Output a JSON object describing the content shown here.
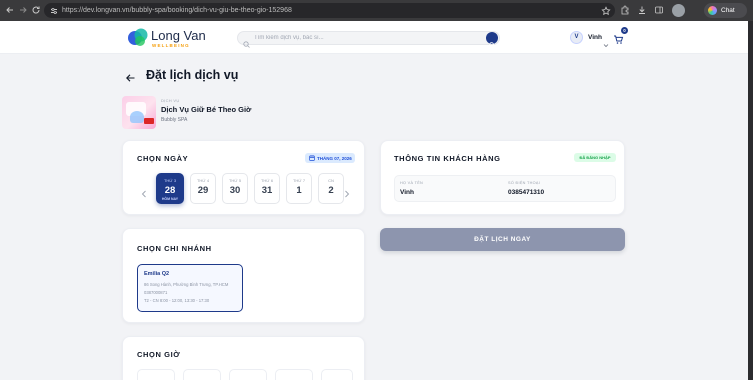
{
  "browser": {
    "url": "https://dev.longvan.vn/bubbly-spa/booking/dich-vu-giu-be-theo-gio-152968",
    "chat_label": "Chat"
  },
  "header": {
    "logo_name": "Long Van",
    "logo_tagline": "WELLBEING",
    "search_placeholder": "Tìm kiếm dịch vụ, bác sĩ...",
    "user_initial": "V",
    "user_name": "Vinh",
    "cart_count": "0"
  },
  "page": {
    "title": "Đặt lịch dịch vụ"
  },
  "service": {
    "category": "DỊCH VỤ",
    "name": "Dịch Vụ Giữ Bé Theo Giờ",
    "provider": "Bubbly SPA"
  },
  "date_picker": {
    "heading": "CHỌN NGÀY",
    "month_badge": "THÁNG 07, 2026",
    "days": [
      {
        "weekday": "THỨ 3",
        "day": "28",
        "note": "HÔM NAY",
        "selected": true
      },
      {
        "weekday": "THỨ 4",
        "day": "29"
      },
      {
        "weekday": "THỨ 5",
        "day": "30"
      },
      {
        "weekday": "THỨ 6",
        "day": "31"
      },
      {
        "weekday": "THỨ 7",
        "day": "1"
      },
      {
        "weekday": "CN",
        "day": "2"
      }
    ]
  },
  "branch_picker": {
    "heading": "CHỌN CHI NHÁNH",
    "branches": [
      {
        "name": "Emilia Q2",
        "address": "86 Song Hành, Phường Bình Trưng, TP.HCM",
        "phone": "0387000871",
        "hours": "T2 - CN 8:00 - 12:00, 13:30 - 17:30",
        "selected": true
      }
    ]
  },
  "time_picker": {
    "heading": "CHỌN GIỜ"
  },
  "customer": {
    "heading": "THÔNG TIN KHÁCH HÀNG",
    "status_badge": "ĐÃ ĐĂNG NHẬP",
    "fields": [
      {
        "label": "HỌ VÀ TÊN",
        "value": "Vinh"
      },
      {
        "label": "SỐ ĐIỆN THOẠI",
        "value": "0385471310"
      }
    ]
  },
  "actions": {
    "book_label": "ĐẶT LỊCH NGAY"
  },
  "colors": {
    "primary": "#1e3a8a",
    "brand_orange": "#f59e0b",
    "success": "#16a34a",
    "button_disabled": "#8d95ae",
    "page_bg": "#f2f3f6"
  },
  "icons": {
    "browser": [
      "back-icon",
      "forward-icon",
      "reload-icon",
      "site-info-icon",
      "star-icon",
      "extensions-icon",
      "download-icon",
      "side-panel-icon"
    ],
    "page": [
      "search-icon",
      "chevron-down-icon",
      "cart-icon",
      "arrow-left-icon",
      "calendar-icon",
      "chevron-left-icon",
      "chevron-right-icon"
    ]
  }
}
